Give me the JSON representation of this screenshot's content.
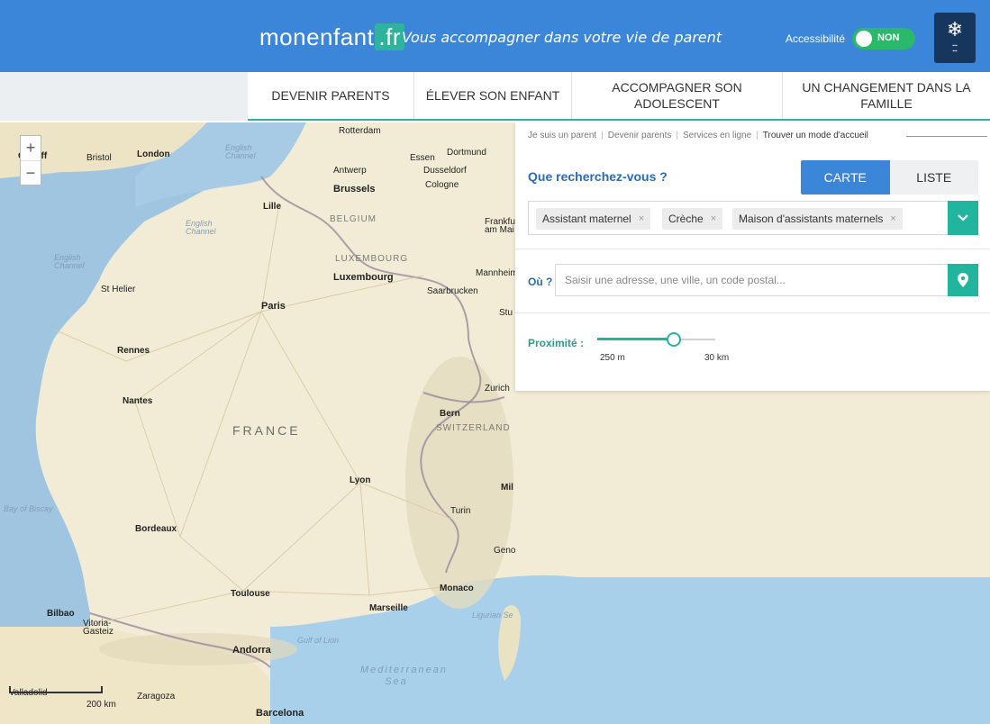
{
  "header": {
    "logo_main": "monenfant",
    "logo_tld": ".fr",
    "tagline": "Vous accompagner dans votre vie de parent",
    "accessibility_label": "Accessibilité",
    "accessibility_toggle": "NON",
    "caf_logo_icon": "caf-emblem-icon"
  },
  "nav": {
    "items": [
      {
        "label": "DEVENIR PARENTS"
      },
      {
        "label": "ÉLEVER SON ENFANT"
      },
      {
        "label": "ACCOMPAGNER SON ADOLESCENT"
      },
      {
        "label": "UN CHANGEMENT DANS LA FAMILLE"
      }
    ]
  },
  "breadcrumb": {
    "items": [
      "Je suis un parent",
      "Devenir parents",
      "Services en ligne",
      "Trouver un mode d'accueil"
    ]
  },
  "search": {
    "question": "Que recherchez-vous ?",
    "view_carte": "CARTE",
    "view_liste": "LISTE",
    "active_view": "CARTE",
    "chips": [
      {
        "label": "Assistant maternel",
        "remove": "×"
      },
      {
        "label": "Crèche",
        "remove": "×"
      },
      {
        "label": "Maison d'assistants maternels",
        "remove": "×"
      }
    ],
    "where_label": "Où ?",
    "address_placeholder": "Saisir une adresse, une ville, un code postal...",
    "proximity_label": "Proximité :",
    "proximity_min": "250 m",
    "proximity_max": "30 km",
    "proximity_value": 0.65
  },
  "map": {
    "zoom_in": "+",
    "zoom_out": "−",
    "scale": "200 km",
    "labels": {
      "cardiff": "Cardiff",
      "bristol": "Bristol",
      "london": "London",
      "english_channel_1": "English Channel",
      "english_channel_2": "English Channel",
      "english_channel_3": "English Channel",
      "rotterdam": "Rotterdam",
      "antwerp": "Antwerp",
      "essen": "Essen",
      "dortmund": "Dortmund",
      "dusseldorf": "Dusseldorf",
      "cologne": "Cologne",
      "brussels": "Brussels",
      "lille": "Lille",
      "belgium": "BELGIUM",
      "frankfurt": "Frankfu am Mai",
      "luxembourg_country": "LUXEMBOURG",
      "luxembourg": "Luxembourg",
      "mannheim": "Mannheim",
      "saarbrucken": "Saarbrucken",
      "st_helier": "St Helier",
      "paris": "Paris",
      "stuttgart": "Stu",
      "rennes": "Rennes",
      "nantes": "Nantes",
      "zurich": "Zurich",
      "bern": "Bern",
      "switzerland": "SWITZERLAND",
      "france": "FRANCE",
      "lyon": "Lyon",
      "milan": "Mil",
      "bay_of_biscay": "Bay of Biscay",
      "bordeaux": "Bordeaux",
      "turin": "Turin",
      "genoa": "Geno",
      "monaco": "Monaco",
      "toulouse": "Toulouse",
      "marseille": "Marseille",
      "ligurian": "Ligurian Se",
      "bilbao": "Bilbao",
      "vitoria": "Vitoria-Gasteiz",
      "gulf_of_lion": "Gulf of Lion",
      "andorra": "Andorra",
      "mediterranean": "Mediterranean Sea",
      "valladolid": "Valladolid",
      "zaragoza": "Zaragoza",
      "barcelona": "Barcelona"
    }
  }
}
